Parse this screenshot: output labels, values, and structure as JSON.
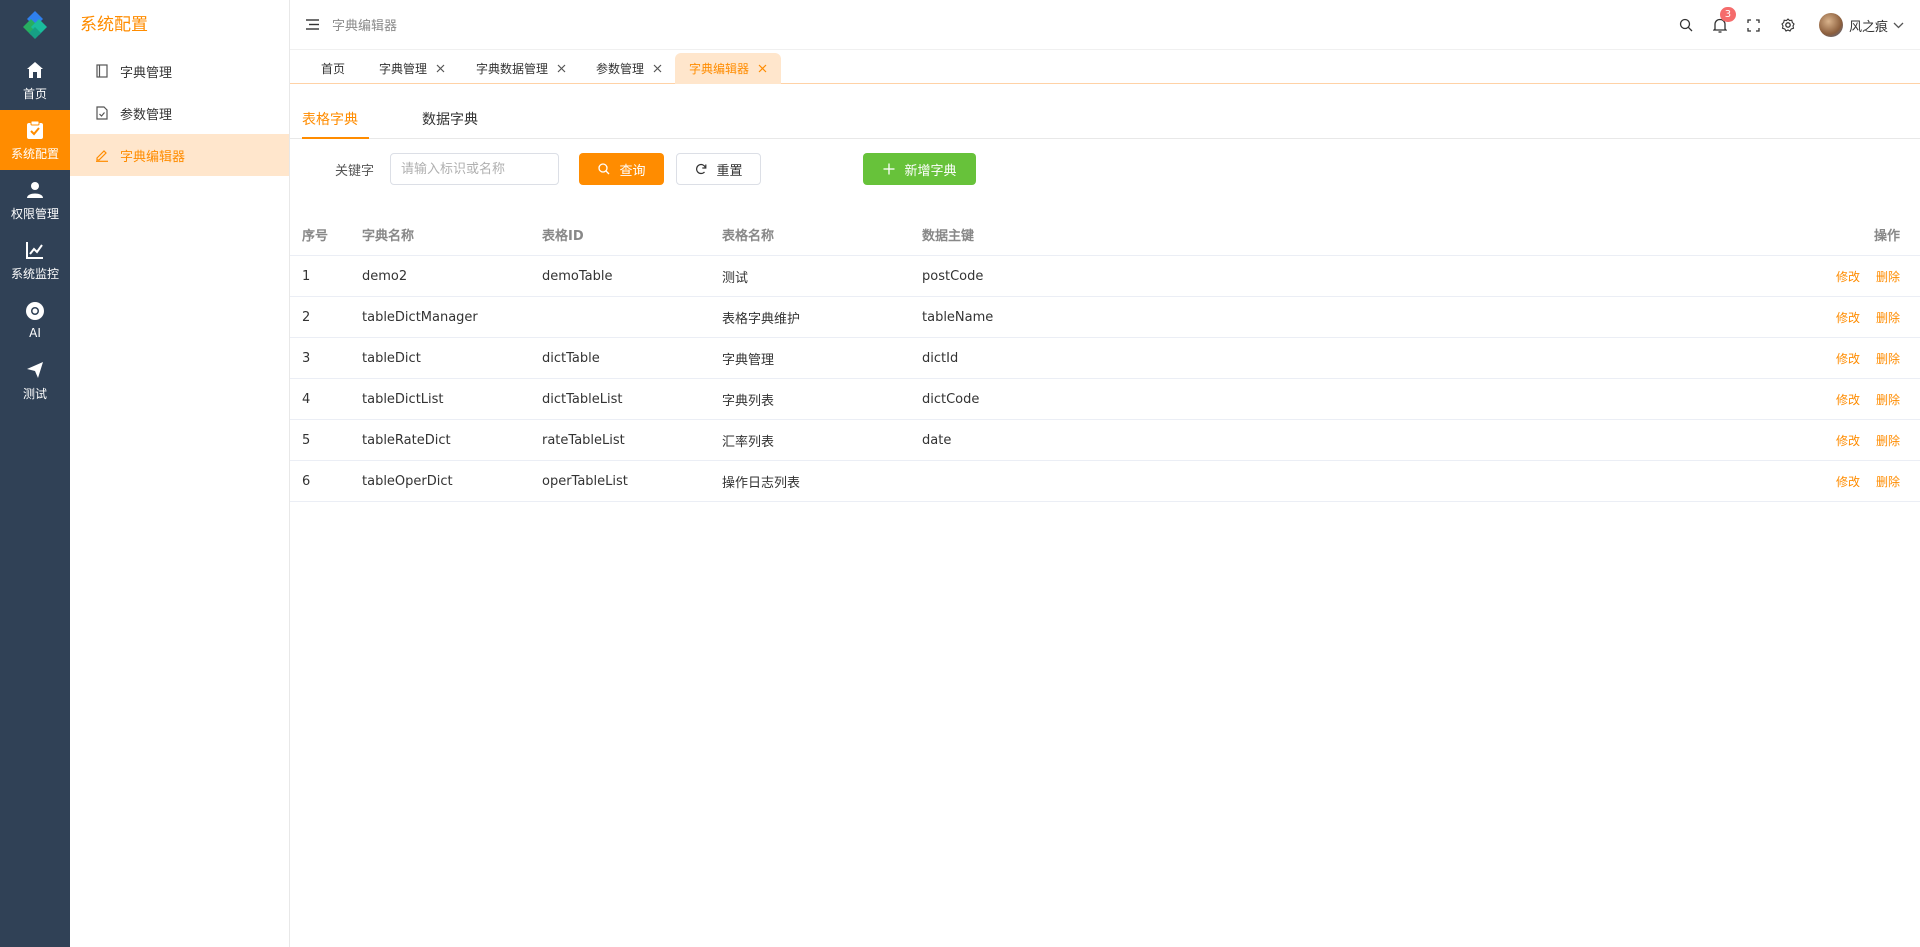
{
  "rail": {
    "items": [
      {
        "label": "首页",
        "icon": "home-icon"
      },
      {
        "label": "系统配置",
        "icon": "clipboard-check-icon"
      },
      {
        "label": "权限管理",
        "icon": "user-icon"
      },
      {
        "label": "系统监控",
        "icon": "chart-line-icon"
      },
      {
        "label": "AI",
        "icon": "chrome-icon"
      },
      {
        "label": "测试",
        "icon": "paper-plane-icon"
      }
    ]
  },
  "submenu": {
    "title": "系统配置",
    "items": [
      {
        "label": "字典管理"
      },
      {
        "label": "参数管理"
      },
      {
        "label": "字典编辑器"
      }
    ]
  },
  "header": {
    "breadcrumb": "字典编辑器",
    "notification_count": "3",
    "username": "风之痕"
  },
  "tabs": [
    {
      "label": "首页"
    },
    {
      "label": "字典管理"
    },
    {
      "label": "字典数据管理"
    },
    {
      "label": "参数管理"
    },
    {
      "label": "字典编辑器"
    }
  ],
  "content_tabs": [
    {
      "label": "表格字典"
    },
    {
      "label": "数据字典"
    }
  ],
  "search": {
    "label": "关键字",
    "placeholder": "请输入标识或名称",
    "query_label": "查询",
    "reset_label": "重置",
    "add_label": "新增字典"
  },
  "table": {
    "headers": [
      "序号",
      "字典名称",
      "表格ID",
      "表格名称",
      "数据主键",
      "操作"
    ],
    "edit_label": "修改",
    "delete_label": "删除",
    "rows": [
      {
        "no": "1",
        "name": "demo2",
        "table_id": "demoTable",
        "table_name": "测试",
        "pk": "postCode"
      },
      {
        "no": "2",
        "name": "tableDictManager",
        "table_id": "",
        "table_name": "表格字典维护",
        "pk": "tableName"
      },
      {
        "no": "3",
        "name": "tableDict",
        "table_id": "dictTable",
        "table_name": "字典管理",
        "pk": "dictId"
      },
      {
        "no": "4",
        "name": "tableDictList",
        "table_id": "dictTableList",
        "table_name": "字典列表",
        "pk": "dictCode"
      },
      {
        "no": "5",
        "name": "tableRateDict",
        "table_id": "rateTableList",
        "table_name": "汇率列表",
        "pk": "date"
      },
      {
        "no": "6",
        "name": "tableOperDict",
        "table_id": "operTableList",
        "table_name": "操作日志列表",
        "pk": ""
      }
    ]
  },
  "colors": {
    "accent": "#ff8c00",
    "rail_bg": "#304156",
    "success": "#67c23a",
    "badge": "#f56c6c"
  }
}
